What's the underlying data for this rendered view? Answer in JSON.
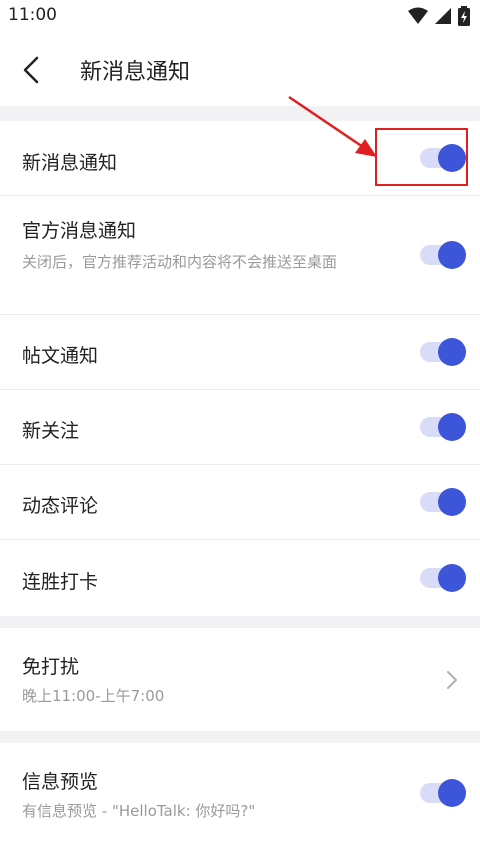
{
  "status_bar": {
    "time": "11:00"
  },
  "header": {
    "title": "新消息通知"
  },
  "notifications": [
    {
      "label": "新消息通知",
      "enabled": true
    },
    {
      "label": "官方消息通知",
      "sublabel": "关闭后，官方推荐活动和内容将不会推送至桌面",
      "enabled": true
    },
    {
      "label": "帖文通知",
      "enabled": true
    },
    {
      "label": "新关注",
      "enabled": true
    },
    {
      "label": "动态评论",
      "enabled": true
    },
    {
      "label": "连胜打卡",
      "enabled": true
    }
  ],
  "dnd": {
    "label": "免打扰",
    "value": "晚上11:00-上午7:00"
  },
  "preview": {
    "label": "信息预览",
    "sublabel": "有信息预览 - \"HelloTalk: 你好吗?\"",
    "enabled": true
  },
  "colors": {
    "accent": "#3d55d8",
    "track": "#d9dcf7",
    "highlight": "#e02020"
  }
}
